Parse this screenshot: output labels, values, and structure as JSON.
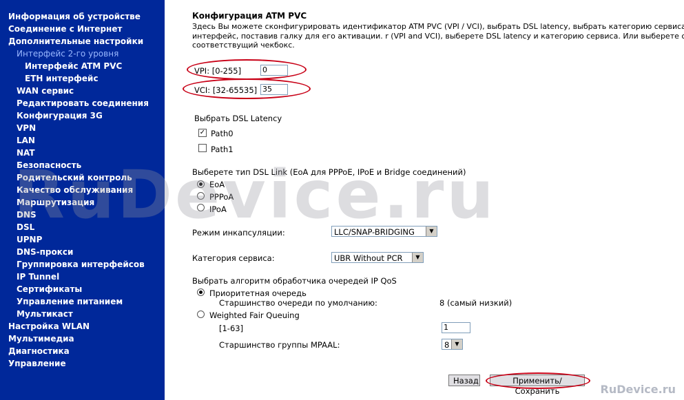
{
  "sidebar": {
    "items": [
      "Информация об устройстве",
      "Соединение с Интернет",
      "Дополнительные настройки",
      "Интерфейс 2-го уровня",
      "Интерфейс ATM PVC",
      "ETH интерфейс",
      "WAN сервис",
      "Редактировать соединения",
      "Конфигурация 3G",
      "VPN",
      "LAN",
      "NAT",
      "Безопасность",
      "Родительский контроль",
      "Качество обслуживания",
      "Маршрутизация",
      "DNS",
      "DSL",
      "UPNP",
      "DNS-прокси",
      "Группировка интерфейсов",
      "IP Tunnel",
      "Сертификаты",
      "Управление питанием",
      "Мультикаст",
      "Настройка WLAN",
      "Мультимедиа",
      "Диагностика",
      "Управление"
    ]
  },
  "main": {
    "title": "Конфигурация ATM PVC",
    "description": "Здесь Вы можете сконфигурировать идентификатор ATM PVC (VPI / VCI), выбрать DSL latency, выбрать категорию сервиса интерфейс, поставив галку для его активации. r (VPI and VCI), выберете DSL latency и категорию сервиса. Или выберете с соответствущий чекбокс.",
    "vpi": {
      "label": "VPI: [0-255]",
      "value": "0"
    },
    "vci": {
      "label": "VCI: [32-65535]",
      "value": "35"
    },
    "latency": {
      "label": "Выбрать DSL Latency",
      "path0": "Path0",
      "path1": "Path1"
    },
    "link": {
      "label": "Выберете тип DSL Link (EoA для PPPoE, IPoE и Bridge соединений)",
      "options": [
        "EoA",
        "PPPoA",
        "IPoA"
      ]
    },
    "encap": {
      "label": "Режим инкапсуляции:",
      "value": "LLC/SNAP-BRIDGING"
    },
    "service": {
      "label": "Категория сервиса:",
      "value": "UBR Without PCR"
    },
    "qos": {
      "label": "Выбрать алгоритм обработчика очередей IP QoS",
      "priority": "Приоритетная очередь",
      "default_prec_label": "Старшинство очереди по умолчанию:",
      "default_prec_value": "8 (самый низкий)",
      "wfq": "Weighted Fair Queuing",
      "range_label": "[1-63]",
      "range_value": "1",
      "mpaal_label": "Старшинство группы MPAAL:",
      "mpaal_value": "8"
    },
    "buttons": {
      "back": "Назад",
      "apply": "Применить/Сохранить"
    }
  },
  "watermark": {
    "main": "RuDevice.ru",
    "corner": "RuDevice.ru"
  },
  "colors": {
    "sidebar": "#00289a",
    "highlight": "#c80016"
  }
}
